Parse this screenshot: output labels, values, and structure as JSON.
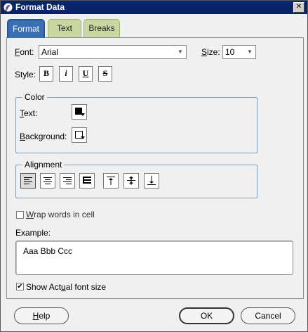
{
  "window": {
    "title": "Format Data",
    "close_glyph": "✕"
  },
  "tabs": [
    {
      "label": "Format",
      "selected": true
    },
    {
      "label": "Text",
      "selected": false
    },
    {
      "label": "Breaks",
      "selected": false
    }
  ],
  "font": {
    "label_first": "F",
    "label_rest": "ont:",
    "value": "Arial"
  },
  "size": {
    "label_first": "S",
    "label_rest": "ize:",
    "value": "10"
  },
  "style": {
    "label": "Style:",
    "buttons": [
      {
        "glyph": "B",
        "icon": "bold-icon"
      },
      {
        "glyph": "i",
        "icon": "italic-icon"
      },
      {
        "glyph": "U",
        "icon": "underline-icon"
      },
      {
        "glyph": "S",
        "icon": "strikethrough-icon"
      }
    ]
  },
  "color": {
    "title": "Color",
    "text_label_first": "T",
    "text_label_rest": "ext:",
    "background_label_first": "B",
    "background_label_rest": "ackground:",
    "text_color": "#000000",
    "background_color": "#ffffff"
  },
  "alignment": {
    "title": "Alignment",
    "horizontal": [
      "align-left-icon",
      "align-center-icon",
      "align-right-icon",
      "align-justify-icon"
    ],
    "vertical": [
      "align-top-icon",
      "align-middle-icon",
      "align-bottom-icon"
    ]
  },
  "wrap": {
    "label_first": "W",
    "label_rest": "rap words in cell",
    "checked": false
  },
  "example": {
    "label": "Example:",
    "text": "Aaa Bbb Ccc"
  },
  "actual": {
    "label_before": "Show Act",
    "label_u": "u",
    "label_after": "al font size",
    "checked": true
  },
  "buttons": {
    "help_first": "H",
    "help_rest": "elp",
    "ok": "OK",
    "cancel": "Cancel"
  },
  "colors": {
    "title_bar": "#0a246a",
    "selected_tab": "#3a6fb2",
    "unselected_tab": "#c9d8a0",
    "group_border": "#7f9db9"
  }
}
